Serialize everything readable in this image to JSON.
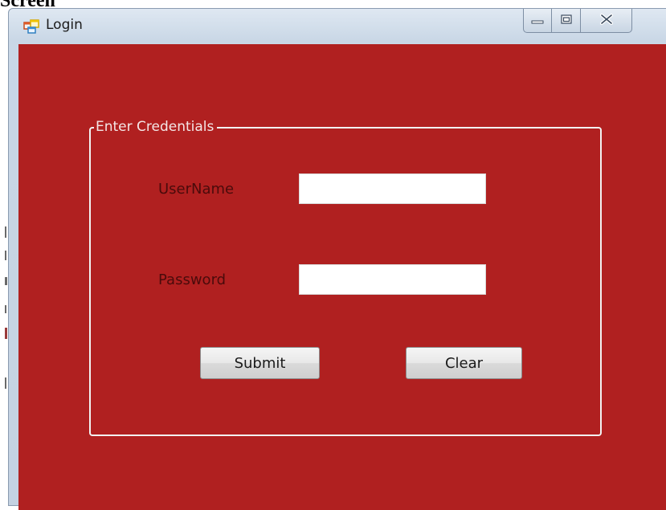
{
  "heading": "Screen",
  "window": {
    "title": "Login",
    "caption_buttons": [
      "minimize",
      "maximize",
      "close"
    ]
  },
  "form": {
    "group_title": "Enter Credentials",
    "username_label": "UserName",
    "username_value": "",
    "password_label": "Password",
    "password_value": "",
    "submit_label": "Submit",
    "clear_label": "Clear"
  },
  "colors": {
    "background": "#b02020",
    "label_text": "#4a0b0b",
    "group_border": "#f2f2f2"
  },
  "icons": {
    "app": "form-window-icon",
    "minimize": "minimize-icon",
    "maximize": "maximize-icon",
    "close": "close-icon"
  }
}
